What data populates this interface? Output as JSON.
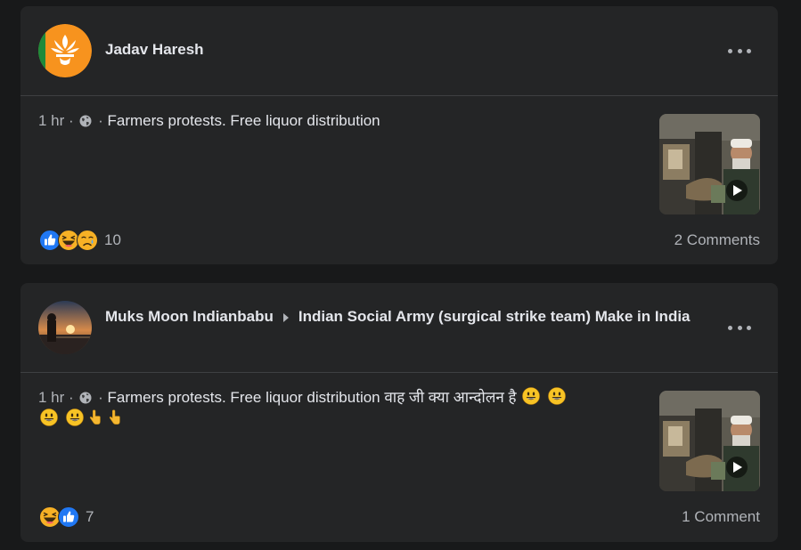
{
  "posts": [
    {
      "author": "Jadav Haresh",
      "group": "",
      "time": "1 hr",
      "text": "Farmers protests. Free liquor distribution",
      "text_extra": "",
      "reaction_count": "10",
      "reactions": [
        "like-icon",
        "laugh-icon",
        "sad-icon"
      ],
      "comments": "2 Comments"
    },
    {
      "author": "Muks Moon Indianbabu",
      "group": "Indian Social Army (surgical strike team) Make in India",
      "time": "1 hr",
      "text": "Farmers protests. Free liquor distribution वाह जी क्या आन्दोलन है",
      "text_extra": "",
      "reaction_count": "7",
      "reactions": [
        "laugh-icon",
        "like-icon"
      ],
      "comments": "1 Comment"
    }
  ],
  "colors": {
    "background": "#18191a",
    "card": "#242526",
    "text": "#e4e6eb",
    "muted": "#b0b3b8",
    "like_blue": "#2078f4",
    "emoji_yellow": "#f7b125"
  }
}
